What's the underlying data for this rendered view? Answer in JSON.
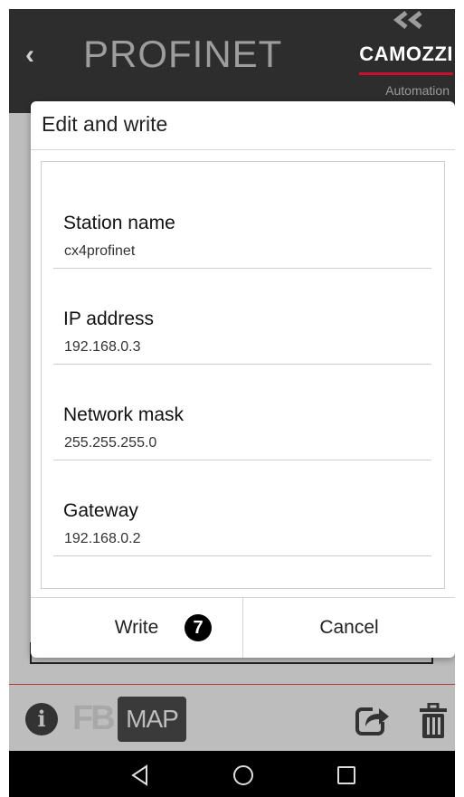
{
  "header": {
    "back_icon": "chevron-left-icon",
    "title": "PROFINET",
    "logo": {
      "brand": "CAMOZZI",
      "subtitle": "Automation",
      "accent": "#c8102e"
    }
  },
  "dialog": {
    "title": "Edit and write",
    "fields": [
      {
        "label": "Station name",
        "value": "cx4profinet"
      },
      {
        "label": "IP address",
        "value": "192.168.0.3"
      },
      {
        "label": "Network mask",
        "value": "255.255.255.0"
      },
      {
        "label": "Gateway",
        "value": "192.168.0.2"
      }
    ],
    "write_label": "Write",
    "step_badge": "7",
    "cancel_label": "Cancel"
  },
  "toolbar": {
    "info_icon": "info-icon",
    "fb_label": "FB",
    "map_label": "MAP",
    "share_icon": "share-icon",
    "trash_icon": "trash-icon"
  },
  "navbar": {
    "back": "back-triangle-icon",
    "home": "home-circle-icon",
    "recents": "recents-square-icon"
  }
}
